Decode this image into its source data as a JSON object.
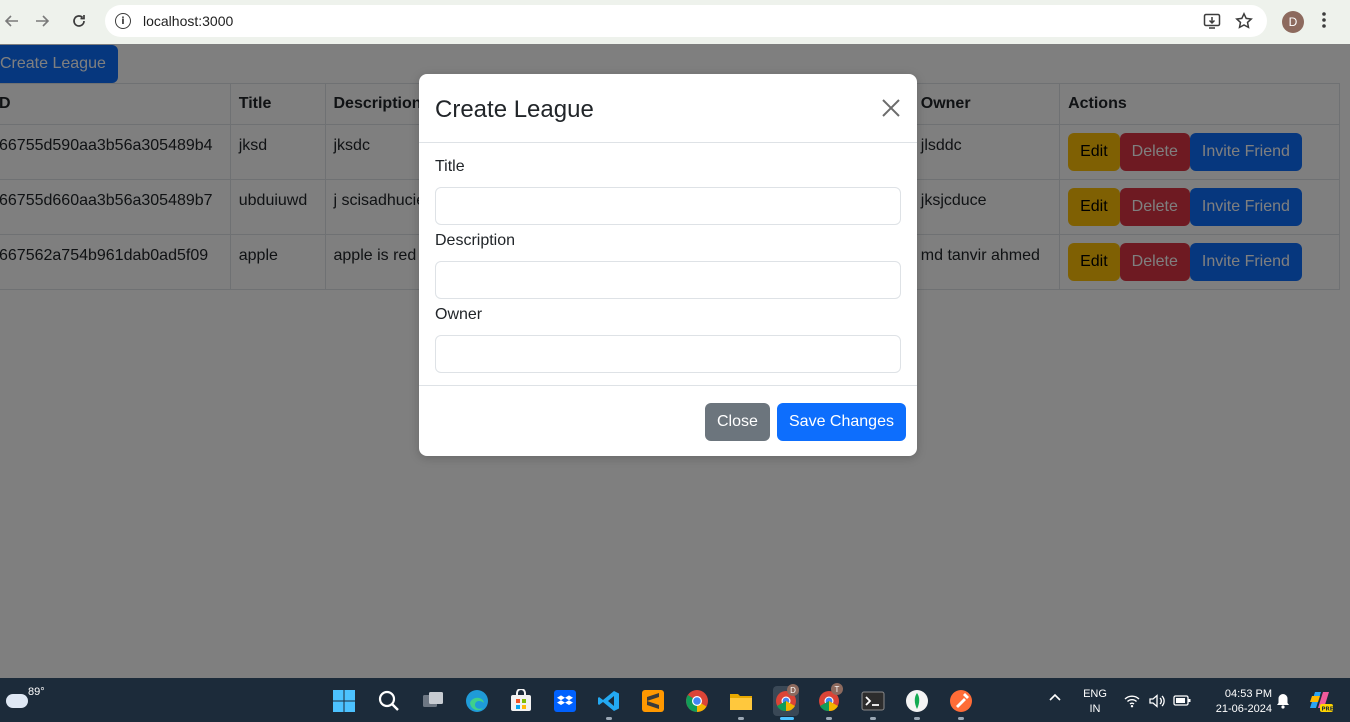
{
  "browser": {
    "url": "localhost:3000",
    "profile_initial": "D",
    "icons": [
      "back-icon",
      "forward-icon",
      "reload-icon",
      "site-info-icon",
      "install-app-icon",
      "bookmark-star-icon",
      "menu-kebab-icon"
    ]
  },
  "page": {
    "create_button": "Create League",
    "table": {
      "headers": {
        "id": "D",
        "title": "Title",
        "description": "Description",
        "owner": "Owner",
        "actions": "Actions"
      },
      "rows": [
        {
          "id": "66755d590aa3b56a305489b4",
          "title": "jksd",
          "description": "jksdc",
          "owner": "jlsddc"
        },
        {
          "id": "66755d660aa3b56a305489b7",
          "title": "ubduiuwd",
          "description": "j scisadhucie",
          "owner": "jksjcduce"
        },
        {
          "id": "667562a754b961dab0ad5f09",
          "title": "apple",
          "description": "apple is red",
          "owner": "md tanvir ahmed"
        }
      ],
      "action_labels": {
        "edit": "Edit",
        "delete": "Delete",
        "invite": "Invite Friend"
      }
    }
  },
  "modal": {
    "title": "Create League",
    "fields": {
      "title_label": "Title",
      "title_value": "",
      "description_label": "Description",
      "description_value": "",
      "owner_label": "Owner",
      "owner_value": ""
    },
    "close_label": "Close",
    "save_label": "Save Changes"
  },
  "taskbar": {
    "weather_temp": "89°",
    "lang_top": "ENG",
    "lang_bottom": "IN",
    "time": "04:53 PM",
    "date": "21-06-2024",
    "chrome_badge_1": "D",
    "chrome_badge_2": "T"
  }
}
